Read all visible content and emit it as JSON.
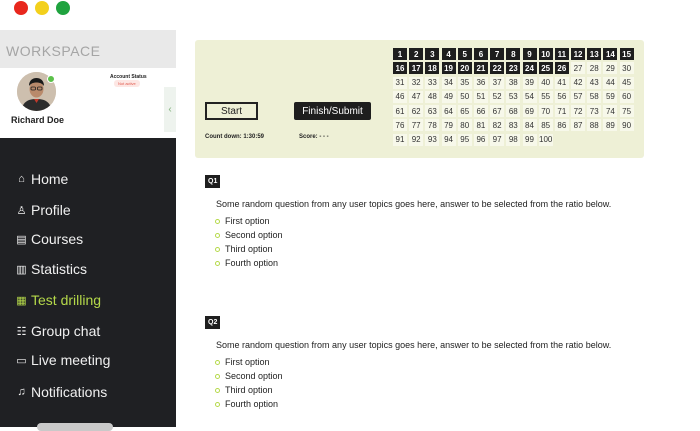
{
  "window": {
    "dots": [
      "#e8271d",
      "#f3d01c",
      "#1fa33f"
    ]
  },
  "sidebar": {
    "workspace_title": "WORKSPACE",
    "user_name": "Richard Doe",
    "account_status_label": "Account Status",
    "account_status_value": "Not active",
    "collapse_icon": "chevron-left-icon",
    "items": [
      {
        "label": "Home",
        "icon": "home-icon",
        "glyph": "⌂"
      },
      {
        "label": "Profile",
        "icon": "user-icon",
        "glyph": "♙"
      },
      {
        "label": "Courses",
        "icon": "courses-icon",
        "glyph": "▤"
      },
      {
        "label": "Statistics",
        "icon": "statistics-icon",
        "glyph": "▥"
      },
      {
        "label": "Test drilling",
        "icon": "clipboard-icon",
        "glyph": "▦",
        "active": true
      },
      {
        "label": "Group chat",
        "icon": "group-chat-icon",
        "glyph": "☷"
      },
      {
        "label": "Live meeting",
        "icon": "video-icon",
        "glyph": "▭"
      },
      {
        "label": "Notifications",
        "icon": "bell-icon",
        "glyph": "♫"
      }
    ]
  },
  "test": {
    "start_label": "Start",
    "finish_label": "Finish/Submit",
    "countdown": "Count down: 1:30:59",
    "score": "Score: - - -",
    "question_numbers": [
      "1",
      "2",
      "3",
      "4",
      "5",
      "6",
      "7",
      "8",
      "9",
      "10",
      "11",
      "12",
      "13",
      "14",
      "15",
      "16",
      "17",
      "18",
      "19",
      "20",
      "21",
      "22",
      "23",
      "24",
      "25",
      "26",
      "27",
      "28",
      "29",
      "30",
      "31",
      "32",
      "33",
      "34",
      "35",
      "36",
      "37",
      "38",
      "39",
      "40",
      "41",
      "42",
      "43",
      "44",
      "45",
      "46",
      "47",
      "48",
      "49",
      "50",
      "51",
      "52",
      "53",
      "54",
      "55",
      "56",
      "57",
      "58",
      "59",
      "60",
      "61",
      "62",
      "63",
      "64",
      "65",
      "66",
      "67",
      "68",
      "69",
      "70",
      "71",
      "72",
      "73",
      "74",
      "75",
      "76",
      "77",
      "78",
      "79",
      "80",
      "81",
      "82",
      "83",
      "84",
      "85",
      "86",
      "87",
      "88",
      "89",
      "90",
      "91",
      "92",
      "93",
      "94",
      "95",
      "96",
      "97",
      "98",
      "99",
      "100"
    ],
    "answered_count": 26,
    "accent_color": "#b5d94a"
  },
  "questions": [
    {
      "tag": "Q1",
      "text": "Some random question from any user topics goes here, answer to be selected from the ratio below.",
      "options": [
        "First option",
        "Second option",
        "Third option",
        "Fourth option"
      ]
    },
    {
      "tag": "Q2",
      "text": "Some random question from any user topics goes here, answer to be selected from the ratio below.",
      "options": [
        "First option",
        "Second option",
        "Third option",
        "Fourth option"
      ]
    }
  ]
}
